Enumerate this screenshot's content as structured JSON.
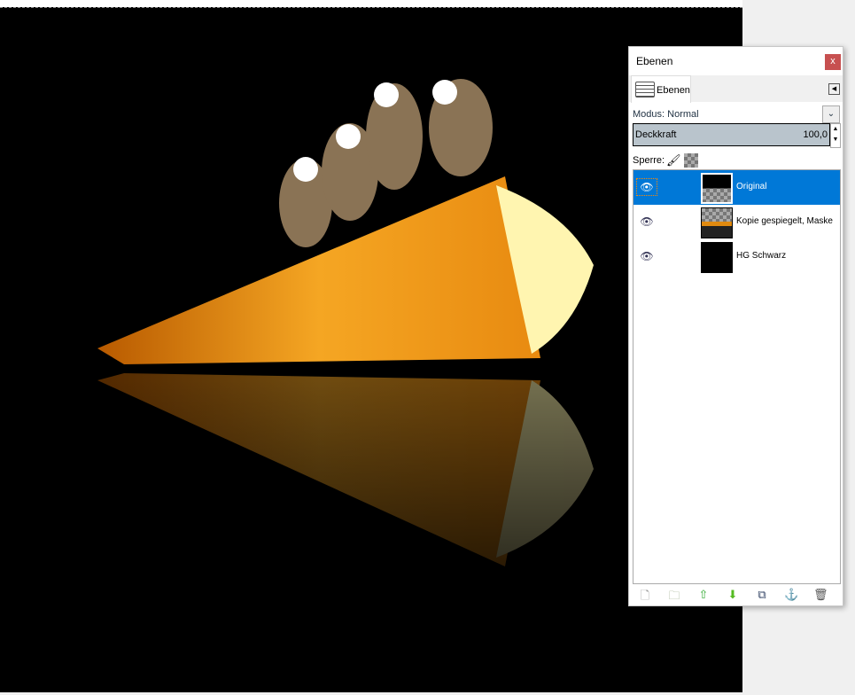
{
  "panel": {
    "title": "Ebenen",
    "close": "x",
    "tab_label": "Ebenen",
    "mode_label": "Modus: Normal",
    "opacity_label": "Deckkraft",
    "opacity_value": "100,0",
    "lock_label": "Sperre:",
    "layers": [
      {
        "name": "Original",
        "selected": true,
        "visible": true
      },
      {
        "name": "Kopie gespiegelt, Maske",
        "visible": true
      },
      {
        "name": "HG Schwarz",
        "visible": true
      }
    ],
    "tools": [
      "new-layer",
      "new-layer-group",
      "raise-layer",
      "lower-layer",
      "duplicate-layer",
      "anchor-layer",
      "delete-layer"
    ]
  },
  "colors": {
    "selection": "#0078d7",
    "cone": "#f0a020"
  }
}
